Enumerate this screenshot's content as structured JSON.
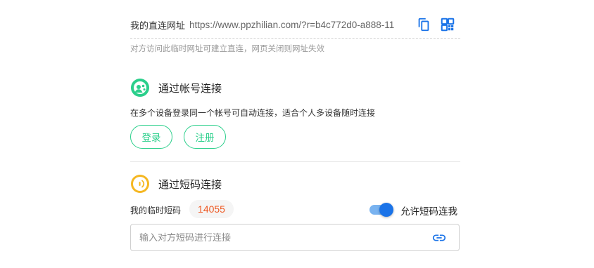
{
  "link": {
    "label": "我的直连网址",
    "url": "https://www.ppzhilian.com/?r=b4c772d0-a888-11",
    "hint": "对方访问此临时网址可建立直连，网页关闭则网址失效",
    "copy_icon": "copy-icon",
    "qr_icon": "qr-code-icon"
  },
  "account": {
    "title": "通过帐号连接",
    "description": "在多个设备登录同一个帐号可自动连接，适合个人多设备随时连接",
    "login_label": "登录",
    "register_label": "注册",
    "icon": "account-connect-icon"
  },
  "shortcode": {
    "title": "通过短码连接",
    "my_code_label": "我的临时短码",
    "my_code": "14055",
    "allow_label": "允许短码连我",
    "allow_enabled": true,
    "input_placeholder": "输入对方短码进行连接",
    "input_value": "",
    "icon": "signal-icon",
    "link_icon": "link-icon"
  },
  "colors": {
    "green": "#2bcf8b",
    "yellow": "#f5b722",
    "blue": "#1a73e8",
    "code_orange": "#ee5a24"
  }
}
